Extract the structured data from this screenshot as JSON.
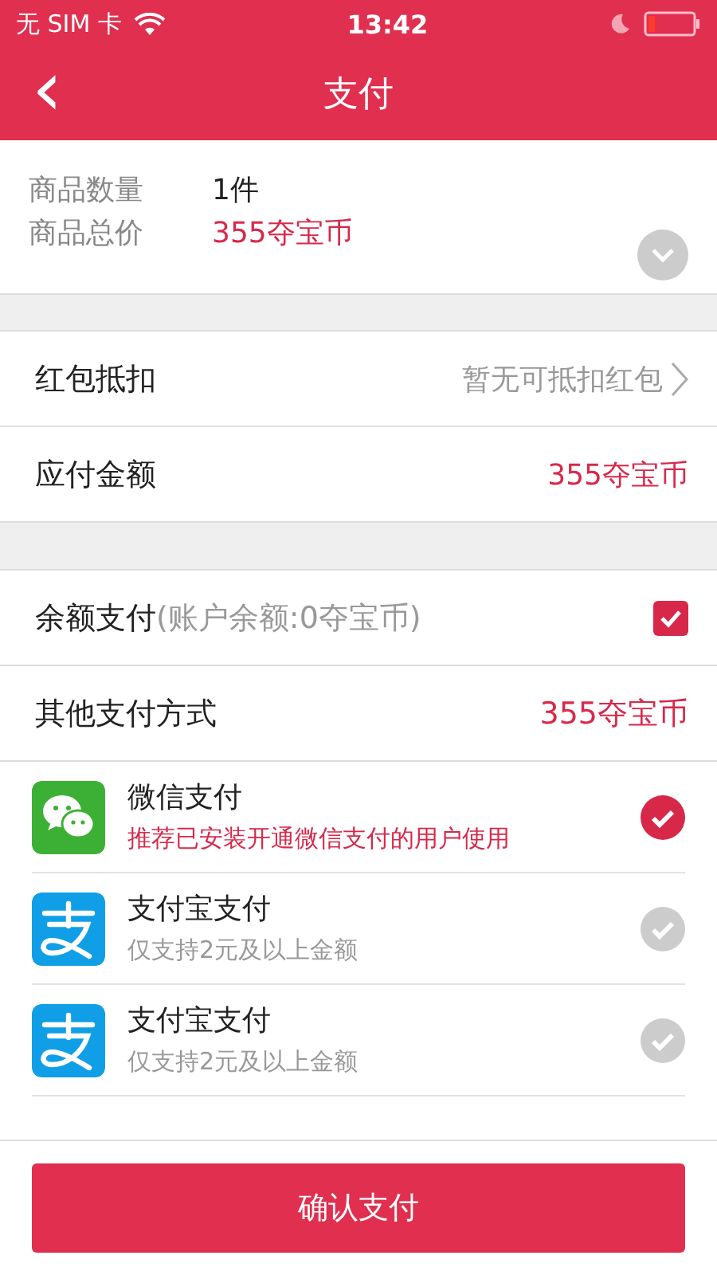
{
  "status_bar": {
    "carrier": "无 SIM 卡",
    "time": "13:42"
  },
  "nav": {
    "back": "‹",
    "title": "支付"
  },
  "summary": [
    {
      "label": "商品数量",
      "value": "1件",
      "accent": false
    },
    {
      "label": "商品总价",
      "value": "355夺宝币",
      "accent": true
    }
  ],
  "rows": [
    {
      "label": "红包抵扣",
      "value": "暂无可抵扣红包",
      "accent": false,
      "chevron": true
    },
    {
      "label": "应付金额",
      "value": "355夺宝币",
      "accent": true,
      "chevron": false
    }
  ],
  "balance": {
    "label": "余额支付",
    "note": "(账户余额:0夺宝币)",
    "checked": true
  },
  "other": {
    "label": "其他支付方式",
    "value": "355夺宝币"
  },
  "methods": [
    {
      "kind": "wechat",
      "name": "微信支付",
      "note": "推荐已安装开通微信支付的用户使用",
      "recommended": true,
      "selected": true
    },
    {
      "kind": "alipay",
      "name": "支付宝支付",
      "note": "仅支持2元及以上金额",
      "recommended": false,
      "selected": false
    },
    {
      "kind": "alipay",
      "name": "支付宝支付",
      "note": "仅支持2元及以上金额",
      "recommended": false,
      "selected": false
    }
  ],
  "confirm": "确认支付"
}
